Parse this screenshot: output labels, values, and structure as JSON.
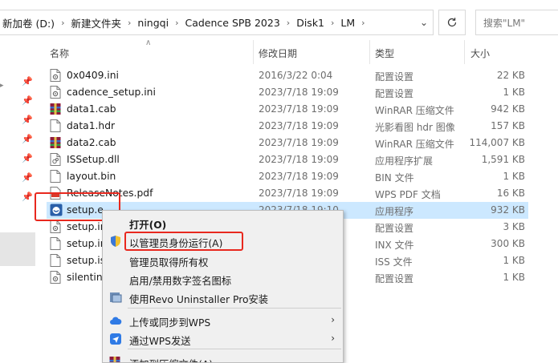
{
  "address": {
    "crumbs": [
      "新加卷 (D:)",
      "新建文件夹",
      "ningqi",
      "Cadence SPB 2023",
      "Disk1",
      "LM"
    ],
    "separator": "›",
    "search_placeholder": "搜索\"LM\""
  },
  "columns": {
    "name": "名称",
    "date": "修改日期",
    "type": "类型",
    "size": "大小"
  },
  "files": [
    {
      "name": "0x0409.ini",
      "date": "2016/3/22 0:04",
      "type": "配置设置",
      "size": "22 KB",
      "icon": "ini-file-icon"
    },
    {
      "name": "cadence_setup.ini",
      "date": "2023/7/18 19:09",
      "type": "配置设置",
      "size": "1 KB",
      "icon": "ini-file-icon"
    },
    {
      "name": "data1.cab",
      "date": "2023/7/18 19:09",
      "type": "WinRAR 压缩文件",
      "size": "942 KB",
      "icon": "winrar-icon"
    },
    {
      "name": "data1.hdr",
      "date": "2023/7/18 19:09",
      "type": "光影看图 hdr 图像",
      "size": "157 KB",
      "icon": "blank-file-icon"
    },
    {
      "name": "data2.cab",
      "date": "2023/7/18 19:09",
      "type": "WinRAR 压缩文件",
      "size": "114,007 KB",
      "icon": "winrar-icon"
    },
    {
      "name": "ISSetup.dll",
      "date": "2023/7/18 19:09",
      "type": "应用程序扩展",
      "size": "1,591 KB",
      "icon": "dll-file-icon"
    },
    {
      "name": "layout.bin",
      "date": "2023/7/18 19:09",
      "type": "BIN 文件",
      "size": "1 KB",
      "icon": "blank-file-icon"
    },
    {
      "name": "ReleaseNotes.pdf",
      "date": "2023/7/18 19:09",
      "type": "WPS PDF 文档",
      "size": "16 KB",
      "icon": "pdf-file-icon"
    },
    {
      "name": "setup.e",
      "date": "2023/7/18 19:10",
      "type": "应用程序",
      "size": "932 KB",
      "icon": "setup-exe-icon",
      "selected": true
    },
    {
      "name": "setup.in",
      "date": "",
      "type": "配置设置",
      "size": "3 KB",
      "icon": "ini-file-icon"
    },
    {
      "name": "setup.in",
      "date": "",
      "type": "INX 文件",
      "size": "300 KB",
      "icon": "blank-file-icon"
    },
    {
      "name": "setup.is",
      "date": "",
      "type": "ISS 文件",
      "size": "1 KB",
      "icon": "blank-file-icon"
    },
    {
      "name": "silentins",
      "date": "",
      "type": "配置设置",
      "size": "1 KB",
      "icon": "ini-file-icon"
    }
  ],
  "context_menu": {
    "items": [
      {
        "label": "打开(O)",
        "bold": true,
        "icon": ""
      },
      {
        "label": "以管理员身份运行(A)",
        "icon": "uac-shield-icon"
      },
      {
        "label": "管理员取得所有权",
        "icon": ""
      },
      {
        "label": "启用/禁用数字签名图标",
        "icon": ""
      },
      {
        "label": "使用Revo Uninstaller Pro安装",
        "icon": "revo-uninstaller-icon"
      },
      {
        "label": "上传或同步到WPS",
        "icon": "wps-cloud-icon",
        "submenu": true
      },
      {
        "label": "通过WPS发送",
        "icon": "wps-send-icon",
        "submenu": true
      },
      {
        "label": "添加到压缩文件(A)...",
        "icon": "winrar-icon"
      }
    ]
  },
  "colors": {
    "selection": "#cce8ff",
    "highlight_red": "#e8281e",
    "menu_bg": "#f0f0f0"
  }
}
